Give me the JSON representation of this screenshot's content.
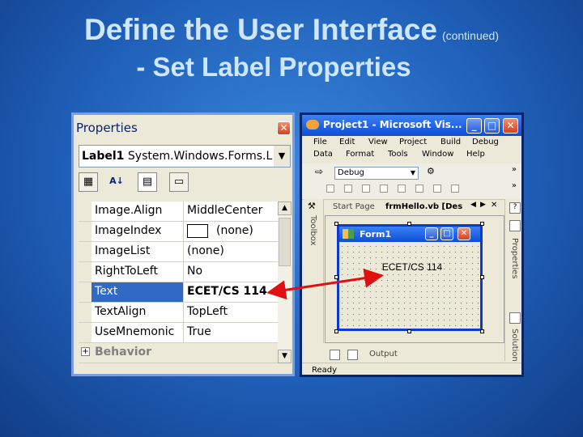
{
  "slide": {
    "title": "Define the User Interface",
    "title_suffix": "(continued)",
    "subtitle": "- Set Label Properties"
  },
  "properties_window": {
    "title": "Properties",
    "object_name": "Label1",
    "object_type": "System.Windows.Forms.L",
    "rows": [
      {
        "name": "Image.Align",
        "value": "MiddleCenter"
      },
      {
        "name": "ImageIndex",
        "value": "(none)"
      },
      {
        "name": "ImageList",
        "value": "(none)"
      },
      {
        "name": "RightToLeft",
        "value": "No"
      },
      {
        "name": "Text",
        "value": "ECET/CS 114"
      },
      {
        "name": "TextAlign",
        "value": "TopLeft"
      },
      {
        "name": "UseMnemonic",
        "value": "True"
      }
    ],
    "category": "Behavior"
  },
  "vs_window": {
    "title": "Project1 - Microsoft Vis...",
    "menus": [
      "File",
      "Edit",
      "View",
      "Project",
      "Build",
      "Debug",
      "Data",
      "Format",
      "Tools",
      "Window",
      "Help"
    ],
    "config_combo": "Debug",
    "tabs": [
      "Start Page",
      "frmHello.vb [Des"
    ],
    "toolbox_label": "Toolbox",
    "properties_label": "Properties",
    "solution_label": "Solution",
    "form_title": "Form1",
    "label_text": "ECET/CS 114",
    "output_label": "Output",
    "status": "Ready"
  },
  "colors": {
    "accent": "#316ac5",
    "arrow": "#e01010",
    "titlebar": "#0b4fd9"
  }
}
